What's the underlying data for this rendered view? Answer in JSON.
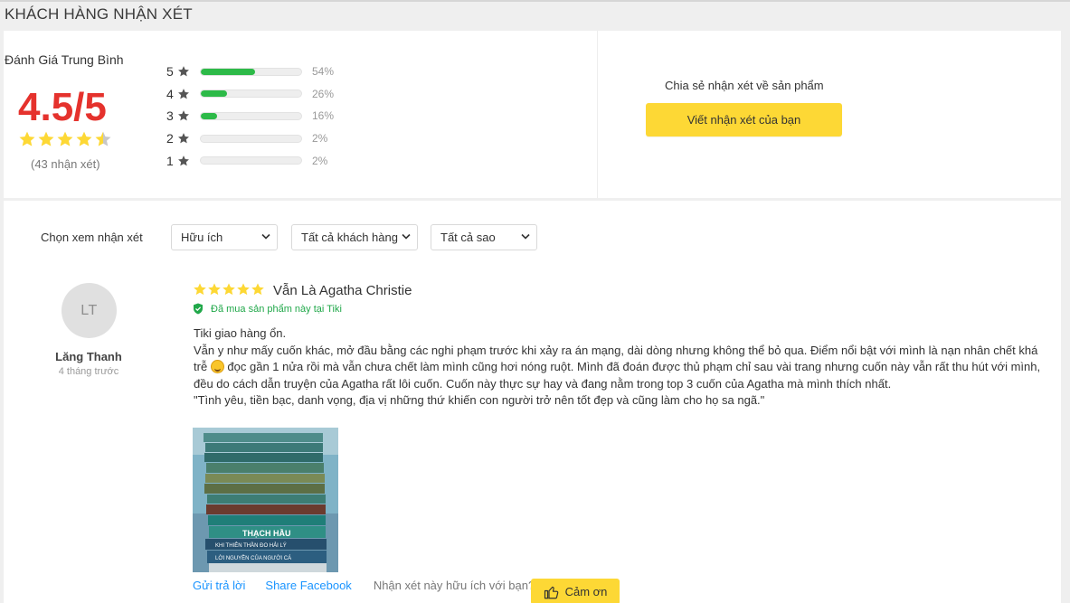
{
  "section_title": "KHÁCH HÀNG NHẬN XÉT",
  "summary": {
    "avg_label": "Đánh Giá Trung Bình",
    "avg_score": "4.5/5",
    "avg_rating": 4.5,
    "review_count": "(43 nhận xét)",
    "distribution": [
      {
        "stars": "5",
        "percent": "54%",
        "fill": 54
      },
      {
        "stars": "4",
        "percent": "26%",
        "fill": 26
      },
      {
        "stars": "3",
        "percent": "16%",
        "fill": 16
      },
      {
        "stars": "2",
        "percent": "2%",
        "fill": 0
      },
      {
        "stars": "1",
        "percent": "2%",
        "fill": 0
      }
    ],
    "share_text": "Chia sẻ nhận xét về sản phẩm",
    "write_button": "Viết nhận xét của bạn"
  },
  "filters": {
    "label": "Chọn xem nhận xét",
    "sort": "Hữu ích",
    "customers": "Tất cả khách hàng",
    "stars": "Tất cả sao"
  },
  "review": {
    "avatar_initials": "LT",
    "reviewer_name": "Lăng Thanh",
    "time": "4 tháng trước",
    "rating": 5,
    "title": "Vẫn Là Agatha Christie",
    "verified": "Đã mua sản phẩm này tại Tiki",
    "line1": "Tiki giao hàng ổn.",
    "line2_a": "Vẫn y như mấy cuốn khác, mở đầu bằng các nghi phạm trước khi xảy ra án mạng, dài dòng nhưng không thể bỏ qua. Điểm nổi bật với mình là nạn nhân chết khá trễ ",
    "line2_b": " đọc gần 1 nửa rồi mà vẫn chưa chết làm mình cũng hơi nóng ruột. Mình đã đoán được thủ phạm chỉ sau vài trang nhưng cuốn này vẫn rất thu hút với mình, đều do cách dẫn truyện của Agatha rất lôi cuốn. Cuốn này thực sự hay và đang nằm trong top 3 cuốn của Agatha mà mình thích nhất.",
    "line3": "\"Tình yêu, tiền bạc, danh vọng, địa vị những thứ khiến con người trở nên tốt đẹp và cũng làm cho họ sa ngã.\"",
    "photo_text": [
      "THẠCH HẦU",
      "KHI THIÊN THẦN ĐO HẢI LÝ",
      "LỜI NGUYỀN CỦA NGƯỜI CÁ"
    ],
    "reply_link": "Gửi trả lời",
    "share_link": "Share Facebook",
    "helpful_question": "Nhận xét này hữu ích với bạn?",
    "thanks_button": "Cảm ơn"
  },
  "colors": {
    "score_red": "#e5322d",
    "star_yellow": "#fdd835",
    "bar_green": "#2dba48",
    "link_blue": "#1a94ff",
    "verified_green": "#21a84a"
  },
  "icons": [
    "star-icon",
    "chevron-down-icon",
    "verified-shield-icon",
    "thumbs-up-icon",
    "laughing-emoji-icon"
  ]
}
